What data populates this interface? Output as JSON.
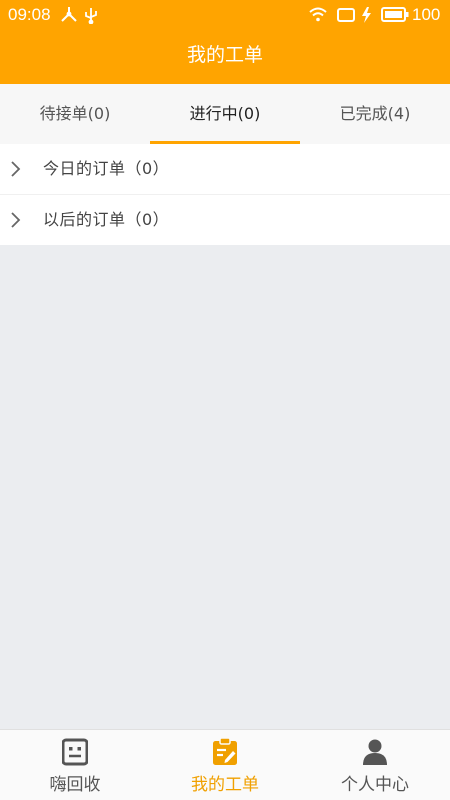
{
  "status_bar": {
    "time": "09:08",
    "battery": "100"
  },
  "header": {
    "title": "我的工单"
  },
  "tabs": [
    {
      "label": "待接单(0)",
      "active": false
    },
    {
      "label": "进行中(0)",
      "active": true
    },
    {
      "label": "已完成(4)",
      "active": false
    }
  ],
  "order_groups": [
    {
      "label": "今日的订单（0）"
    },
    {
      "label": "以后的订单（0）"
    }
  ],
  "bottom_nav": [
    {
      "label": "嗨回收",
      "icon": "robot-face-icon",
      "active": false
    },
    {
      "label": "我的工单",
      "icon": "clipboard-edit-icon",
      "active": true
    },
    {
      "label": "个人中心",
      "icon": "person-icon",
      "active": false
    }
  ],
  "colors": {
    "accent": "#ffa400",
    "active_label": "#f0a000",
    "background": "#ebedf0"
  }
}
